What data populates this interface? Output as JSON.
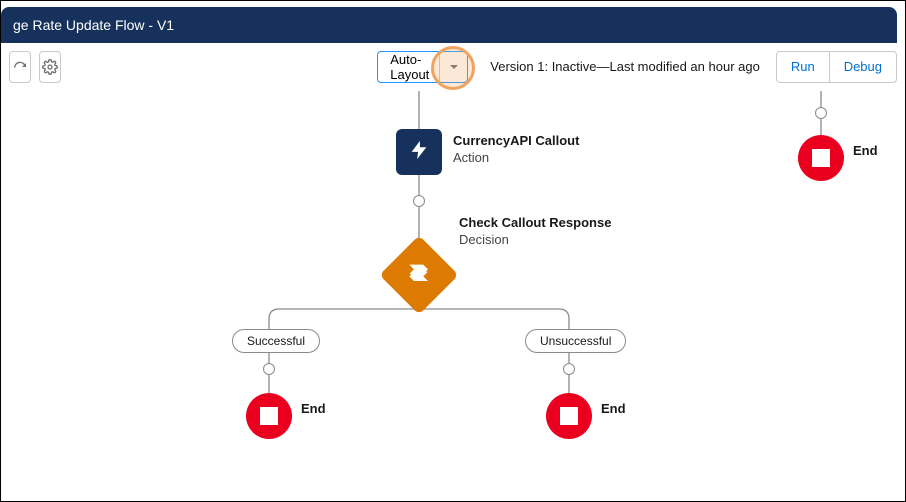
{
  "header": {
    "title": "ge Rate Update Flow - V1"
  },
  "toolbar": {
    "layout_mode": "Auto-Layout",
    "status_text": "Version 1: Inactive—Last modified an hour ago",
    "run_label": "Run",
    "debug_label": "Debug"
  },
  "nodes": {
    "action": {
      "title": "CurrencyAPI Callout",
      "subtitle": "Action"
    },
    "decision": {
      "title": "Check Callout Response",
      "subtitle": "Decision"
    },
    "branches": {
      "left": "Successful",
      "right": "Unsuccessful"
    },
    "end_label": "End"
  },
  "colors": {
    "header_bg": "#16325c",
    "action_bg": "#16325c",
    "decision_bg": "#dd7a01",
    "end_bg": "#ea001e",
    "link_blue": "#0070d2",
    "highlight": "#f0a35e"
  }
}
